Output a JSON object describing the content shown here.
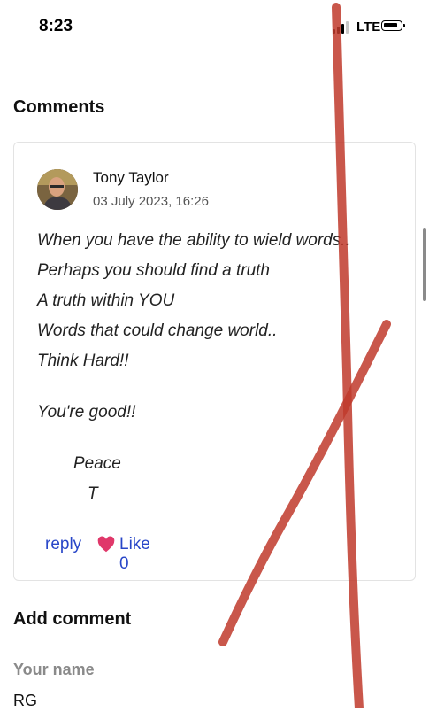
{
  "status_bar": {
    "time": "8:23",
    "network": "LTE",
    "icons": [
      "signal-icon",
      "battery-icon"
    ]
  },
  "comments_section": {
    "title": "Comments"
  },
  "comment": {
    "author": "Tony Taylor",
    "date": "03 July 2023, 16:26",
    "lines": [
      "When you have the ability to wield words..",
      "Perhaps you should find a truth",
      "A truth within YOU",
      "Words that could change world..",
      "Think Hard!!",
      "You're good!!",
      "Peace",
      "T"
    ],
    "reply_label": "reply",
    "like_label": "Like 0"
  },
  "add_comment": {
    "title": "Add comment",
    "name_label": "Your name",
    "name_value": "RG"
  },
  "colors": {
    "link": "#2846c8",
    "heart": "#e0386a",
    "annotation": "#c0392b"
  }
}
